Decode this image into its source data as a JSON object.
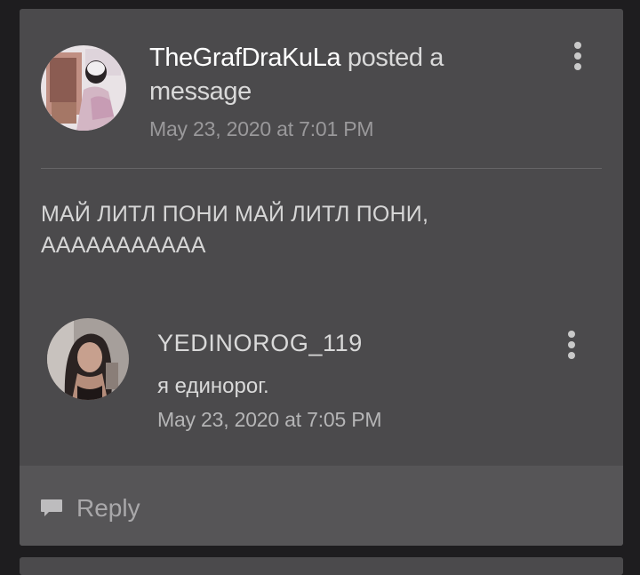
{
  "post": {
    "author": "TheGrafDraKuLa",
    "action_text": " posted a message",
    "timestamp": "May 23, 2020 at 7:01 PM",
    "body": "МАЙ ЛИТЛ ПОНИ МАЙ ЛИТЛ ПОНИ, ААААААААААА",
    "menu_icon": "more-vertical-icon"
  },
  "comment": {
    "author": "YEDINOROG_119",
    "text": "я единорог.",
    "timestamp": "May 23, 2020 at 7:05 PM",
    "menu_icon": "more-vertical-icon"
  },
  "footer": {
    "reply_label": "Reply",
    "reply_icon": "comment-bubble-icon"
  },
  "colors": {
    "background": "#1e1d1f",
    "card": "#4b4a4c",
    "footer": "#565557",
    "primary_text": "#d9d9d9",
    "muted_text": "#9a999b"
  }
}
